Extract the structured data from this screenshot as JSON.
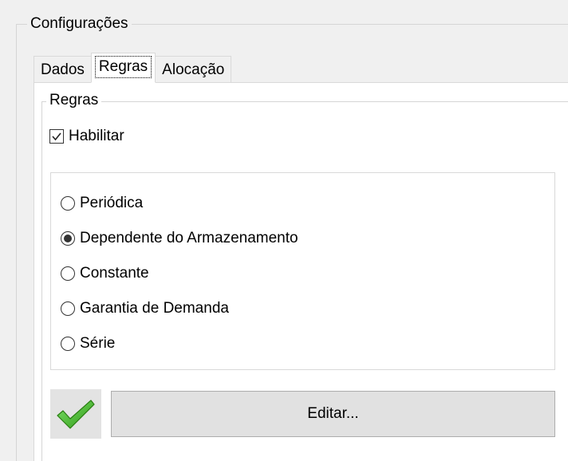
{
  "settings_group": {
    "title": "Configurações"
  },
  "tabs": [
    {
      "label": "Dados",
      "active": false
    },
    {
      "label": "Regras",
      "active": true
    },
    {
      "label": "Alocação",
      "active": false
    }
  ],
  "rules_group": {
    "title": "Regras",
    "enable_checkbox": {
      "label": "Habilitar",
      "checked": true
    },
    "rule_options": [
      {
        "label": "Periódica",
        "selected": false
      },
      {
        "label": "Dependente do Armazenamento",
        "selected": true
      },
      {
        "label": "Constante",
        "selected": false
      },
      {
        "label": "Garantia de Demanda",
        "selected": false
      },
      {
        "label": "Série",
        "selected": false
      }
    ],
    "status_icon": "green-checkmark-icon",
    "edit_button_label": "Editar..."
  },
  "colors": {
    "window_background": "#f0f0f0",
    "tab_page_background": "#ffffff",
    "button_background": "#e1e1e1",
    "check_green": "#3aa91e"
  }
}
